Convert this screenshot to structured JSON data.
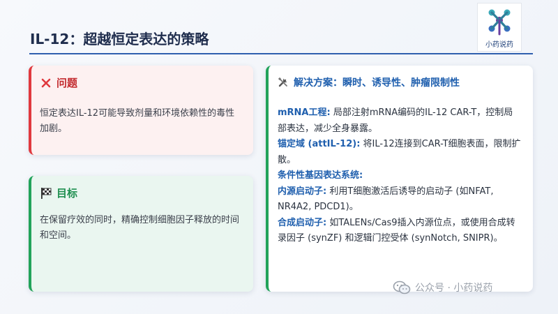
{
  "slide": {
    "title": "IL-12：超越恒定表达的策略"
  },
  "logo": {
    "text": "小药说药"
  },
  "problem": {
    "icon": "x-icon",
    "title": "问题",
    "body": "恒定表达IL-12可能导致剂量和环境依赖性的毒性加剧。"
  },
  "goal": {
    "icon": "checkered-flag-icon",
    "title": "目标",
    "body": "在保留疗效的同时，精确控制细胞因子释放的时间和空间。"
  },
  "solution": {
    "icon": "tools-icon",
    "title": "解决方案：瞬时、诱导性、肿瘤限制性",
    "items": [
      {
        "term": "mRNA工程:",
        "text": " 局部注射mRNA编码的IL-12 CAR-T，控制局部表达，减少全身暴露。"
      },
      {
        "term": "锚定域 (attIL-12):",
        "text": " 将IL-12连接到CAR-T细胞表面，限制扩散。"
      }
    ],
    "subheading": "条件性基因表达系统:",
    "subitems": [
      {
        "term": "内源启动子:",
        "text": " 利用T细胞激活后诱导的启动子 (如NFAT, NR4A2, PDCD1)。"
      },
      {
        "term": "合成启动子:",
        "text": " 如TALENs/Cas9插入内源位点，或使用合成转录因子 (synZF) 和逻辑门控受体 (synNotch, SNIPR)。"
      }
    ]
  },
  "watermark": {
    "icon": "wechat-icon",
    "text": "公众号 · 小药说药"
  },
  "colors": {
    "problem_accent": "#e0393e",
    "goal_accent": "#22a35a",
    "solution_heading": "#1f5fae",
    "title_line": "#2f5fae"
  }
}
